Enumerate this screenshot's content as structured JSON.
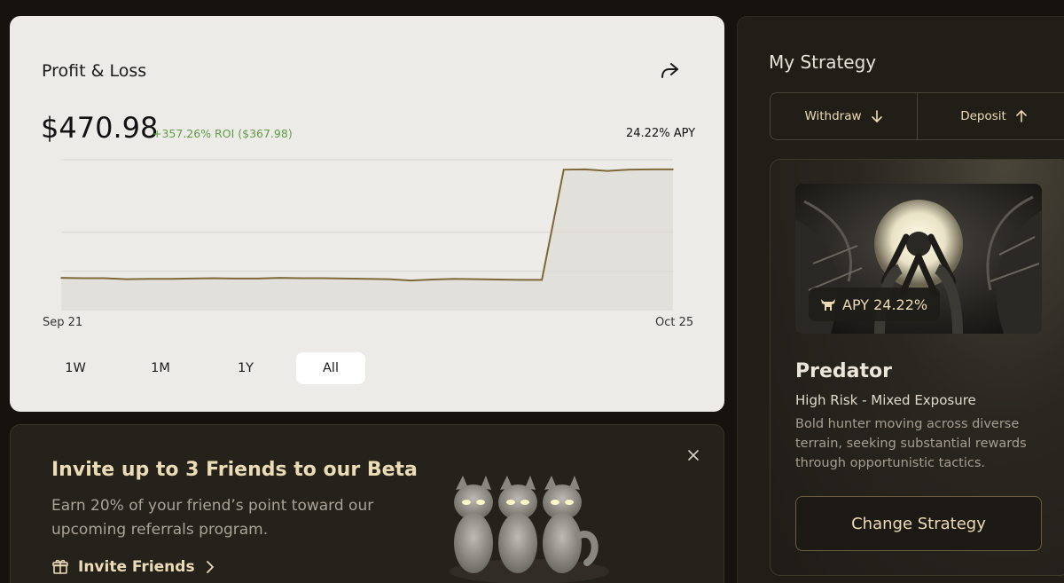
{
  "pnl": {
    "title": "Profit & Loss",
    "share_icon": "share-icon",
    "value": "$470.98",
    "roi": "+357.26% ROI ($367.98)",
    "apy": "24.22% APY",
    "ranges": [
      "1W",
      "1M",
      "1Y",
      "All"
    ],
    "active_range": "All"
  },
  "chart_data": {
    "type": "area",
    "x_labels": [
      "Sep 21",
      "Oct 25"
    ],
    "values": [
      102,
      101,
      101,
      98,
      99,
      99,
      100,
      101,
      100,
      100,
      102,
      101,
      101,
      100,
      99,
      98,
      94,
      97,
      99,
      98,
      97,
      96,
      96,
      440,
      441,
      436,
      440,
      441,
      441
    ],
    "ylim": [
      0,
      470.98
    ],
    "grid": true,
    "line_color": "#7d6838"
  },
  "invite": {
    "title": "Invite up to 3 Friends to our Beta",
    "description": "Earn 20% of your friend’s point toward our upcoming referrals program.",
    "link_label": "Invite Friends",
    "gift_icon": "gift-icon",
    "close_icon": "close-icon"
  },
  "strategy": {
    "title": "My Strategy",
    "withdraw_label": "Withdraw",
    "deposit_label": "Deposit",
    "apy_badge": "APY 24.22%",
    "name": "Predator",
    "risk": "High Risk - Mixed Exposure",
    "description": "Bold hunter moving across diverse terrain, seeking substantial rewards through opportunistic tactics.",
    "change_label": "Change Strategy"
  },
  "colors": {
    "accent": "#ecdcb6",
    "positive": "#5f9d46",
    "background": "#16130f",
    "card_light": "#ecebe7"
  }
}
